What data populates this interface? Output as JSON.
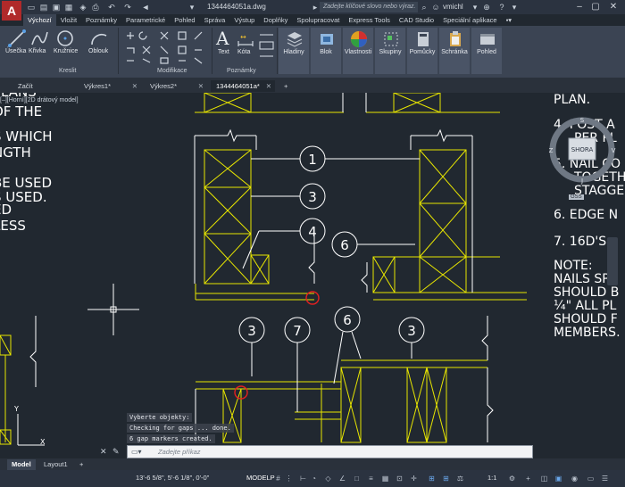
{
  "app": {
    "logo_text": "A",
    "document_title": "1344464051a.dwg"
  },
  "search": {
    "placeholder": "Zadejte klíčové slovo nebo výraz."
  },
  "user": {
    "name": "vmichl"
  },
  "ribbon_tabs": [
    "Výchozí",
    "Vložit",
    "Poznámky",
    "Parametrické",
    "Pohled",
    "Správa",
    "Výstup",
    "Doplňky",
    "Spolupracovat",
    "Express Tools",
    "CAD Studio",
    "Speciální aplikace"
  ],
  "ribbon": {
    "draw": {
      "line": "Úsečka",
      "polyline": "Křivka",
      "circle": "Kružnice",
      "arc": "Oblouk",
      "title": "Kreslit"
    },
    "modify": {
      "title": "Modifikace"
    },
    "annotation": {
      "text": "Text",
      "dimension": "Kóta",
      "title": "Poznámky"
    },
    "layers": "Hladiny",
    "block": "Blok",
    "properties": "Vlastnosti",
    "groups": "Skupiny",
    "utilities": "Pomůcky",
    "clipboard": "Schránka",
    "view": "Pohled"
  },
  "file_tabs": [
    "Začít",
    "Výkres1*",
    "Výkres2*",
    "1344464051a*"
  ],
  "viewport_label": "[–][Horní][2D drátový model]",
  "viewcube": {
    "label": "SHORA",
    "north": "S",
    "east": "V",
    "west": "Z",
    "south": "J",
    "ucs": "GSS"
  },
  "drawing_text": {
    "left": [
      "PLANS",
      "OF THE",
      "S WHICH",
      "NGTH",
      "BE USED",
      "S USED.",
      "ED",
      "LESS"
    ],
    "right": [
      "PLAN.",
      "4. POST A",
      "PER PL",
      "5. NAIL CO",
      "TOGETH",
      "STAGGER",
      "6. EDGE N",
      "7. 16D'S",
      "NOTE:",
      "NAILS SPA",
      "SHOULD B",
      "¼\" ALL PL",
      "SHOULD F",
      "MEMBERS."
    ],
    "callouts": [
      "1",
      "3",
      "4",
      "6",
      "3",
      "7",
      "6",
      "3"
    ]
  },
  "command_history": [
    "Vyberte objekty:",
    "Checking for gaps ... done.",
    "6 gap markers created."
  ],
  "command_line": {
    "placeholder": "Zadejte příkaz"
  },
  "layout_tabs": [
    "Model",
    "Layout1",
    "+"
  ],
  "status": {
    "coords": "13'-6 5/8\", 5'-6 1/8\", 0'-0\"",
    "mode": "MODELP",
    "scale": "1:1"
  },
  "colors": {
    "geometry": "#e8e600",
    "annotation": "#ffffff",
    "marker": "#e52020",
    "background": "#212830"
  }
}
